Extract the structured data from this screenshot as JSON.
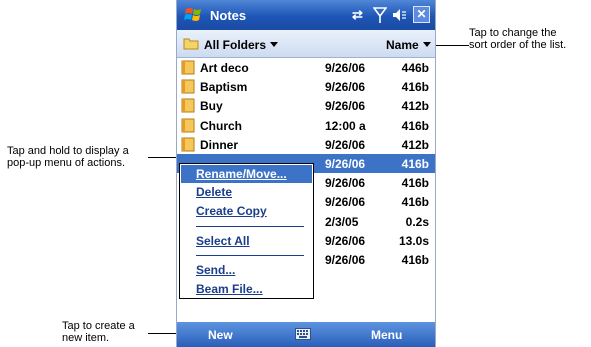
{
  "app": {
    "title": "Notes"
  },
  "toolbar": {
    "folder": "All Folders",
    "sort": "Name"
  },
  "notes": [
    {
      "name": "Art deco",
      "date": "9/26/06",
      "size": "446b"
    },
    {
      "name": "Baptism",
      "date": "9/26/06",
      "size": "416b"
    },
    {
      "name": "Buy",
      "date": "9/26/06",
      "size": "412b"
    },
    {
      "name": "Church",
      "date": "12:00 a",
      "size": "416b"
    },
    {
      "name": "Dinner",
      "date": "9/26/06",
      "size": "412b"
    },
    {
      "name": "",
      "date": "9/26/06",
      "size": "416b"
    },
    {
      "name": "",
      "date": "9/26/06",
      "size": "416b"
    },
    {
      "name": "",
      "date": "9/26/06",
      "size": "416b"
    },
    {
      "name": "",
      "date": "2/3/05",
      "size": "0.2s"
    },
    {
      "name": "",
      "date": "9/26/06",
      "size": "13.0s"
    },
    {
      "name": "",
      "date": "9/26/06",
      "size": "416b"
    }
  ],
  "popup_menu": {
    "rename_move": "Rename/Move...",
    "delete": "Delete",
    "create_copy": "Create Copy",
    "select_all": "Select All",
    "send": "Send...",
    "beam_file": "Beam File..."
  },
  "softkeys": {
    "left": "New",
    "right": "Menu"
  },
  "callouts": {
    "sort": [
      "Tap to change the",
      "sort order of the list."
    ],
    "hold": [
      "Tap and hold to display a",
      "pop-up menu of actions."
    ],
    "create": [
      "Tap to create a",
      "new item."
    ]
  },
  "colors": {
    "titlebar": "#1e56b6",
    "selection": "#3d73c6",
    "menu_text": "#1a3e8a"
  }
}
